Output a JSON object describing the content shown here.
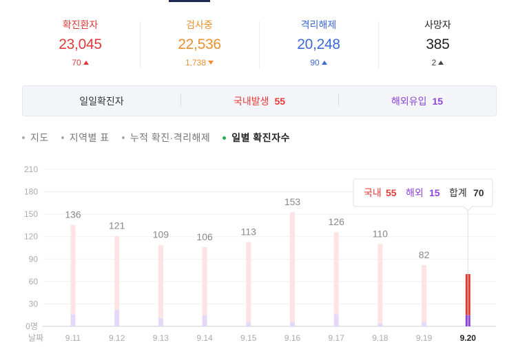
{
  "stats": [
    {
      "label": "확진환자",
      "value": "23,045",
      "change": "70",
      "direction": "up",
      "color": "#e03a3a"
    },
    {
      "label": "검사중",
      "value": "22,536",
      "change": "1,738",
      "direction": "down",
      "color": "#ef8f2f"
    },
    {
      "label": "격리해제",
      "value": "20,248",
      "change": "90",
      "direction": "up",
      "color": "#3b69d6"
    },
    {
      "label": "사망자",
      "value": "385",
      "change": "2",
      "direction": "up",
      "color": "#222222"
    }
  ],
  "daily": {
    "title": "일일확진자",
    "domestic_label": "국내발생",
    "domestic_value": "55",
    "overseas_label": "해외유입",
    "overseas_value": "15"
  },
  "tabs": [
    {
      "label": "지도",
      "active": false
    },
    {
      "label": "지역별 표",
      "active": false
    },
    {
      "label": "누적 확진·격리해제",
      "active": false
    },
    {
      "label": "일별 확진자수",
      "active": true
    }
  ],
  "colors": {
    "domestic": "#e53935",
    "overseas": "#8e44d9",
    "domestic_faded": "#fde3e3",
    "overseas_faded": "#e6d8f7"
  },
  "chart_data": {
    "type": "bar",
    "stacked": true,
    "categories": [
      "9.11",
      "9.12",
      "9.13",
      "9.14",
      "9.15",
      "9.16",
      "9.17",
      "9.18",
      "9.19",
      "9.20"
    ],
    "x_axis_title": "날짜",
    "y_ticks": [
      "210",
      "180",
      "150",
      "120",
      "90",
      "60",
      "30",
      "0명"
    ],
    "ylim": [
      0,
      210
    ],
    "series": [
      {
        "name": "국내",
        "values": [
          120,
          99,
          98,
          91,
          108,
          147,
          110,
          106,
          76,
          55
        ]
      },
      {
        "name": "해외",
        "values": [
          16,
          22,
          11,
          15,
          5,
          6,
          16,
          4,
          6,
          15
        ]
      }
    ],
    "totals": [
      136,
      121,
      109,
      106,
      113,
      153,
      126,
      110,
      82,
      70
    ],
    "total_labels": [
      "136",
      "121",
      "109",
      "106",
      "113",
      "153",
      "126",
      "110",
      "82",
      ""
    ],
    "highlight_index": 9,
    "tooltip": {
      "domestic_label": "국내",
      "domestic_value": "55",
      "overseas_label": "해외",
      "overseas_value": "15",
      "total_label": "합계",
      "total_value": "70"
    }
  }
}
